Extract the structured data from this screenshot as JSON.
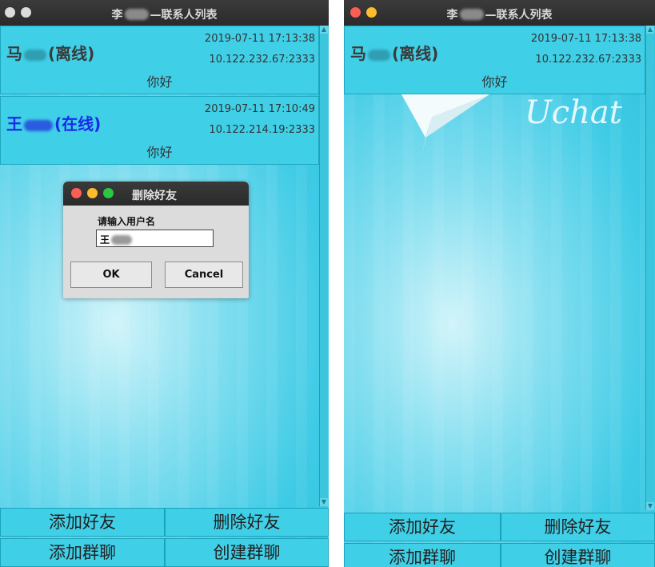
{
  "colors": {
    "titlebar": "#2e2e2e",
    "close": "#fd5d55",
    "minimize": "#fdbb2e",
    "zoom": "#28c840",
    "inactive_dot": "#dcdcdc",
    "contact_bg": "#3fcfe7",
    "online_name": "#1a2ae8"
  },
  "left": {
    "title_prefix": "李",
    "title_suffix": "—联系人列表",
    "contacts": [
      {
        "name": "马",
        "status": "(离线)",
        "time": "2019-07-11 17:13:38",
        "ip": "10.122.232.67:2333",
        "message": "你好"
      },
      {
        "name": "王",
        "status": "(在线)",
        "time": "2019-07-11 17:10:49",
        "ip": "10.122.214.19:2333",
        "message": "你好"
      }
    ],
    "dialog": {
      "title": "删除好友",
      "label": "请输入用户名",
      "input_value": "王",
      "ok": "OK",
      "cancel": "Cancel"
    },
    "buttons": {
      "add_friend": "添加好友",
      "delete_friend": "删除好友",
      "add_group": "添加群聊",
      "create_group": "创建群聊"
    }
  },
  "right": {
    "title_prefix": "李",
    "title_suffix": "—联系人列表",
    "contacts": [
      {
        "name": "马",
        "status": "(离线)",
        "time": "2019-07-11 17:13:38",
        "ip": "10.122.232.67:2333",
        "message": "你好"
      }
    ],
    "logo_text": "Uchat",
    "buttons": {
      "add_friend": "添加好友",
      "delete_friend": "删除好友",
      "add_group": "添加群聊",
      "create_group": "创建群聊"
    }
  }
}
